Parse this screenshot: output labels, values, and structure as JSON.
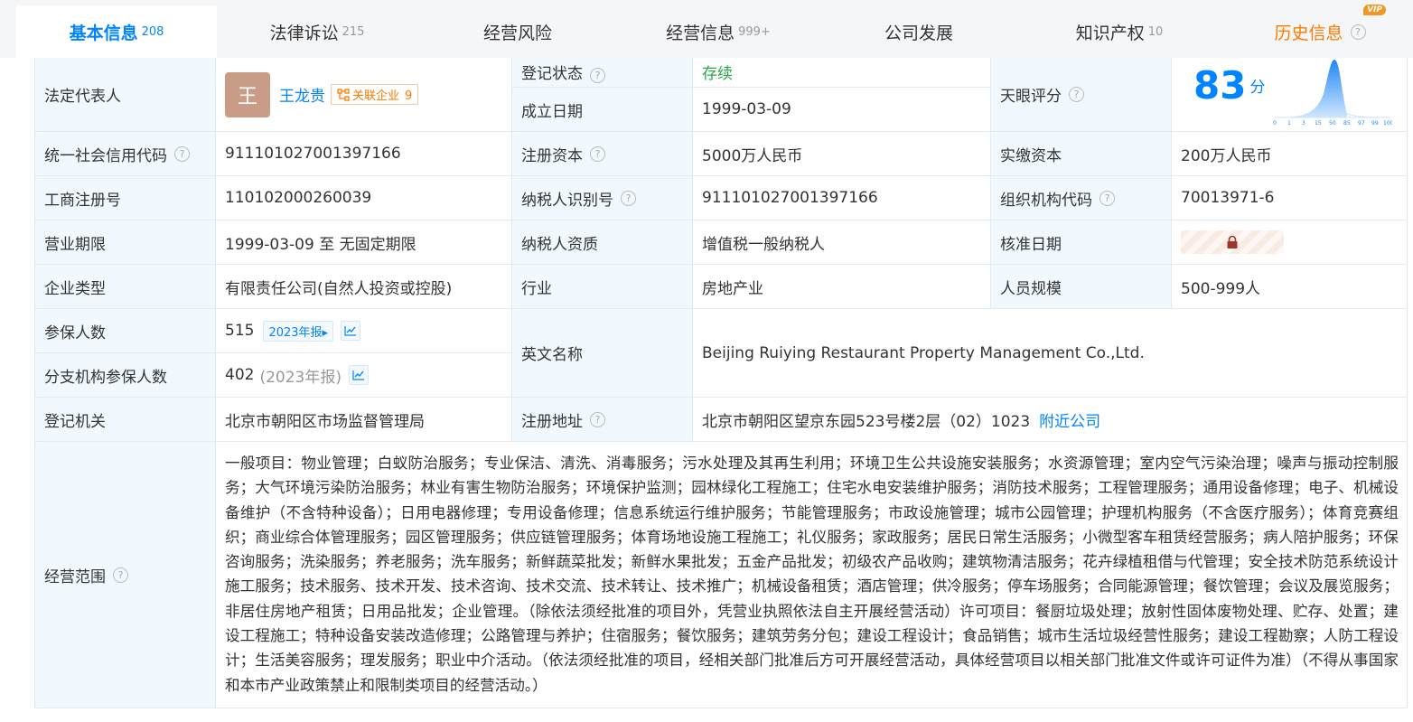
{
  "tabs": [
    {
      "label": "基本信息",
      "count": "208"
    },
    {
      "label": "法律诉讼",
      "count": "215"
    },
    {
      "label": "经营风险",
      "count": ""
    },
    {
      "label": "经营信息",
      "count": "999+"
    },
    {
      "label": "公司发展",
      "count": ""
    },
    {
      "label": "知识产权",
      "count": "10"
    },
    {
      "label": "历史信息",
      "count": "",
      "badge": "VIP"
    }
  ],
  "info": {
    "legal_rep": {
      "label": "法定代表人",
      "avatar": "王",
      "name": "王龙贵",
      "tag": "关联企业",
      "tag_count": "9"
    },
    "status": {
      "label": "登记状态",
      "value": "存续"
    },
    "founded": {
      "label": "成立日期",
      "value": "1999-03-09"
    },
    "tianyan": {
      "label": "天眼评分",
      "score": "83",
      "unit": "分",
      "curve_ticks": [
        "0",
        "1",
        "3",
        "15",
        "50",
        "85",
        "97",
        "99",
        "100"
      ]
    },
    "credit_code": {
      "label": "统一社会信用代码",
      "value": "911101027001397166"
    },
    "reg_capital": {
      "label": "注册资本",
      "value": "5000万人民币"
    },
    "paid_capital": {
      "label": "实缴资本",
      "value": "200万人民币"
    },
    "biz_reg_no": {
      "label": "工商注册号",
      "value": "110102000260039"
    },
    "taxpayer_id": {
      "label": "纳税人识别号",
      "value": "911101027001397166"
    },
    "org_code": {
      "label": "组织机构代码",
      "value": "70013971-6"
    },
    "term": {
      "label": "营业期限",
      "value": "1999-03-09 至 无固定期限"
    },
    "taxpayer_qual": {
      "label": "纳税人资质",
      "value": "增值税一般纳税人"
    },
    "approval_date": {
      "label": "核准日期"
    },
    "company_type": {
      "label": "企业类型",
      "value": "有限责任公司(自然人投资或控股)"
    },
    "industry": {
      "label": "行业",
      "value": "房地产业"
    },
    "staff_size": {
      "label": "人员规模",
      "value": "500-999人"
    },
    "insured": {
      "label": "参保人数",
      "value": "515",
      "report": "2023年报"
    },
    "branch_insured": {
      "label": "分支机构参保人数",
      "value": "402",
      "report": "(2023年报)"
    },
    "english_name": {
      "label": "英文名称",
      "value": "Beijing Ruiying Restaurant Property Management Co.,Ltd."
    },
    "reg_authority": {
      "label": "登记机关",
      "value": "北京市朝阳区市场监督管理局"
    },
    "reg_address": {
      "label": "注册地址",
      "value": "北京市朝阳区望京东园523号楼2层（02）1023",
      "link": "附近公司"
    },
    "scope": {
      "label": "经营范围",
      "value": "一般项目：物业管理；白蚁防治服务；专业保洁、清洗、消毒服务；污水处理及其再生利用；环境卫生公共设施安装服务；水资源管理；室内空气污染治理；噪声与振动控制服务；大气环境污染防治服务；林业有害生物防治服务；环境保护监测；园林绿化工程施工；住宅水电安装维护服务；消防技术服务；工程管理服务；通用设备修理；电子、机械设备维护（不含特种设备）；日用电器修理；专用设备修理；信息系统运行维护服务；节能管理服务；市政设施管理；城市公园管理；护理机构服务（不含医疗服务）；体育竞赛组织；商业综合体管理服务；园区管理服务；供应链管理服务；体育场地设施工程施工；礼仪服务；家政服务；居民日常生活服务；小微型客车租赁经营服务；病人陪护服务；环保咨询服务；洗染服务；养老服务；洗车服务；新鲜蔬菜批发；新鲜水果批发；五金产品批发；初级农产品收购；建筑物清洁服务；花卉绿植租借与代管理；安全技术防范系统设计施工服务；技术服务、技术开发、技术咨询、技术交流、技术转让、技术推广；机械设备租赁；酒店管理；供冷服务；停车场服务；合同能源管理；餐饮管理；会议及展览服务；非居住房地产租赁；日用品批发；企业管理。（除依法须经批准的项目外，凭营业执照依法自主开展经营活动）许可项目：餐厨垃圾处理；放射性固体废物处理、贮存、处置；建设工程施工；特种设备安装改造修理；公路管理与养护；住宿服务；餐饮服务；建筑劳务分包；建设工程设计；食品销售；城市生活垃圾经营性服务；建设工程勘察；人防工程设计；生活美容服务；理发服务；职业中介活动。（依法须经批准的项目，经相关部门批准后方可开展经营活动，具体经营项目以相关部门批准文件或许可证件为准）（不得从事国家和本市产业政策禁止和限制类项目的经营活动。）"
    }
  },
  "colors": {
    "accent": "#0084ff",
    "label_bg": "#f2f9fe",
    "border": "#e4eaf1",
    "orange": "#ff7a00",
    "status_green": "#28a745"
  }
}
